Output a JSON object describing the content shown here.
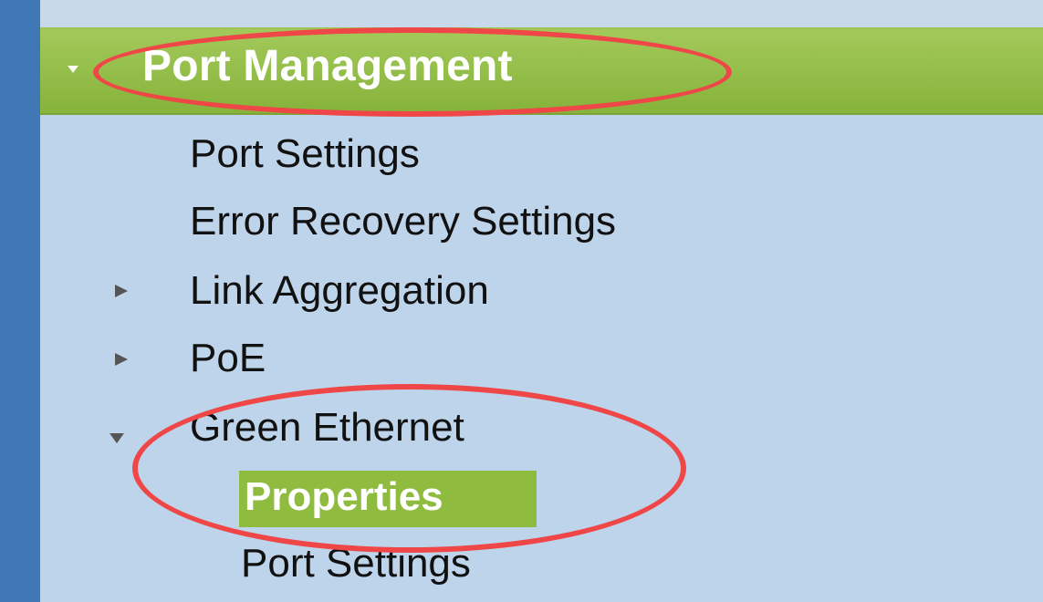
{
  "menu": {
    "section_title": "Port Management",
    "items": [
      {
        "label": "Port Settings"
      },
      {
        "label": "Error Recovery Settings"
      },
      {
        "label": "Link Aggregation",
        "expander": "collapsed-arrow"
      },
      {
        "label": "PoE",
        "expander": "collapsed-arrow"
      },
      {
        "label": "Green Ethernet",
        "expander": "expanded-arrow"
      },
      {
        "label": "Properties",
        "state": "selected"
      },
      {
        "label": "Port Settings"
      }
    ]
  },
  "annotations": {
    "highlight_color": "#ef4747",
    "targets": [
      "Port Management",
      "Green Ethernet / Properties"
    ]
  },
  "colors": {
    "left_rail": "#3f78b4",
    "panel_bg": "#bed4ea",
    "header_green": "#8fbb3f",
    "selected_bg": "#8fbb3f"
  }
}
